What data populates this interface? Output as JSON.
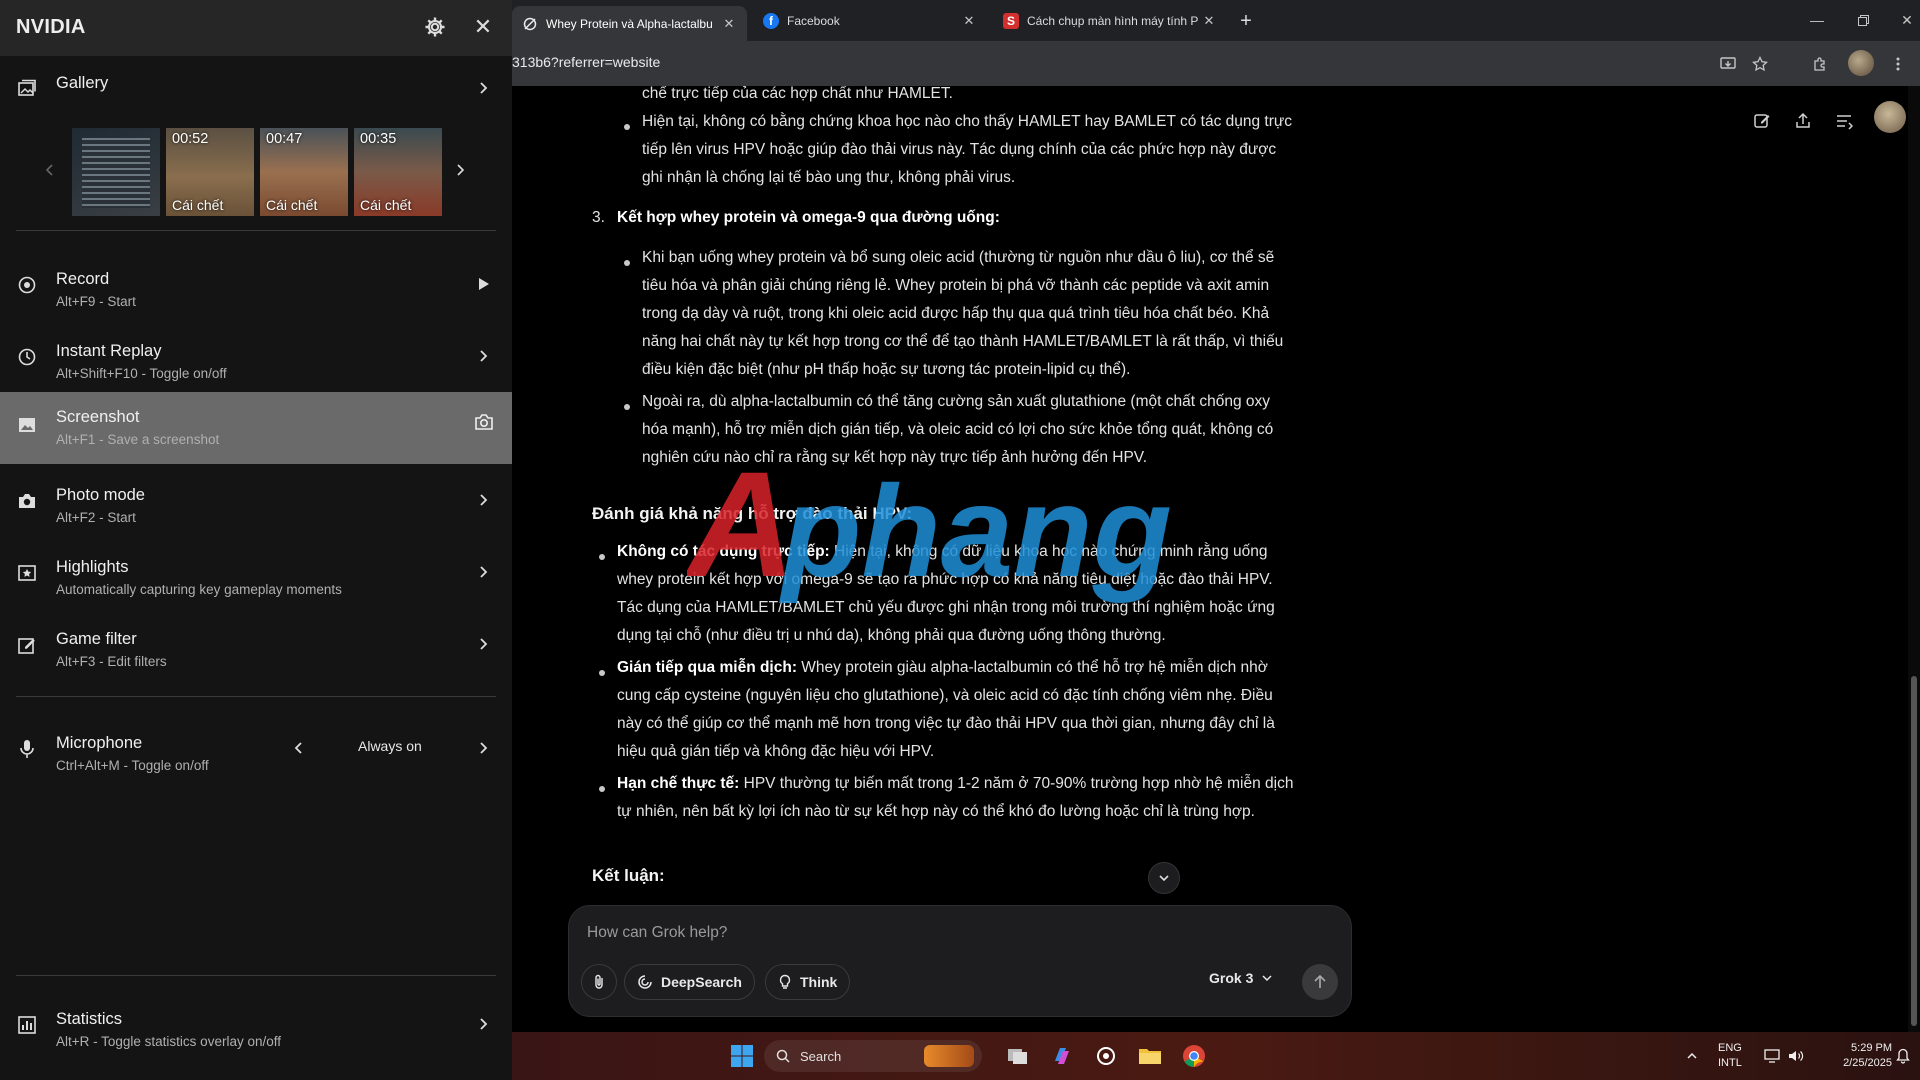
{
  "browser": {
    "tabs": [
      {
        "title": "Whey Protein và Alpha-lactalbu",
        "active": true
      },
      {
        "title": "Facebook",
        "active": false
      },
      {
        "title": "Cách chụp màn hình máy tính P",
        "active": false
      }
    ],
    "url": "313b6?referrer=website"
  },
  "article": {
    "lines_top": [
      "chế trực tiếp của các hợp chất như HAMLET.",
      "Hiện tại, không có bằng chứng khoa học nào cho thấy HAMLET hay BAMLET có tác dụng trực",
      "tiếp lên virus HPV hoặc giúp đào thải virus này. Tác dụng chính của các phức hợp này được",
      "ghi nhận là chống lại tế bào ung thư, không phải virus."
    ],
    "item3_num": "3.",
    "item3_title": "Kết hợp whey protein và omega-9 qua đường uống:",
    "item3_b1": [
      "Khi bạn uống whey protein và bổ sung oleic acid (thường từ nguồn như dầu ô liu), cơ thể sẽ",
      "tiêu hóa và phân giải chúng riêng lẻ. Whey protein bị phá vỡ thành các peptide và axit amin",
      "trong dạ dày và ruột, trong khi oleic acid được hấp thụ qua quá trình tiêu hóa chất béo. Khả",
      "năng hai chất này tự kết hợp trong cơ thể để tạo thành HAMLET/BAMLET là rất thấp, vì thiếu",
      "điều kiện đặc biệt (như pH thấp hoặc sự tương tác protein-lipid cụ thể)."
    ],
    "item3_b2": [
      "Ngoài ra, dù alpha-lactalbumin có thể tăng cường sản xuất glutathione (một chất chống oxy",
      "hóa mạnh), hỗ trợ miễn dịch gián tiếp, và oleic acid có lợi cho sức khỏe tổng quát, không có",
      "nghiên cứu nào chỉ ra rằng sự kết hợp này trực tiếp ảnh hưởng đến HPV."
    ],
    "heading_eval": "Đánh giá khả năng hỗ trợ đào thải HPV:",
    "eval1_bold": "Không có tác dụng trực tiếp:",
    "eval1": [
      " Hiện tại, không có dữ liệu khoa học nào chứng minh rằng uống",
      "whey protein kết hợp với omega-9 sẽ tạo ra phức hợp có khả năng tiêu diệt hoặc đào thải HPV.",
      "Tác dụng của HAMLET/BAMLET chủ yếu được ghi nhận trong môi trường thí nghiệm hoặc ứng",
      "dụng tại chỗ (như điều trị u nhú da), không phải qua đường uống thông thường."
    ],
    "eval2_bold": "Gián tiếp qua miễn dịch:",
    "eval2": [
      " Whey protein giàu alpha-lactalbumin có thể hỗ trợ hệ miễn dịch nhờ",
      "cung cấp cysteine (nguyên liệu cho glutathione), và oleic acid có đặc tính chống viêm nhẹ. Điều",
      "này có thể giúp cơ thể mạnh mẽ hơn trong việc tự đào thải HPV qua thời gian, nhưng đây chỉ là",
      "hiệu quả gián tiếp và không đặc hiệu với HPV."
    ],
    "eval3_bold": "Hạn chế thực tế:",
    "eval3": [
      " HPV thường tự biến mất trong 1-2 năm ở 70-90% trường hợp nhờ hệ miễn dịch",
      "tự nhiên, nên bất kỳ lợi ích nào từ sự kết hợp này có thể khó đo lường hoặc chỉ là trùng hợp."
    ],
    "heading_conclusion": "Kết luận:"
  },
  "watermark": "Aphang",
  "chat": {
    "placeholder": "How can Grok help?",
    "deepsearch": "DeepSearch",
    "think": "Think",
    "model": "Grok 3"
  },
  "taskbar": {
    "search": "Search",
    "lang": "ENG",
    "layout": "INTL",
    "time": "5:29 PM",
    "date": "2/25/2025"
  },
  "nvidia": {
    "title": "NVIDIA",
    "gallery": "Gallery",
    "thumbs": [
      {
        "duration": "",
        "caption": ""
      },
      {
        "duration": "00:52",
        "caption": "Cái chết"
      },
      {
        "duration": "00:47",
        "caption": "Cái chết"
      },
      {
        "duration": "00:35",
        "caption": "Cái chết"
      }
    ],
    "items": [
      {
        "label": "Record",
        "sub": "Alt+F9 - Start"
      },
      {
        "label": "Instant Replay",
        "sub": "Alt+Shift+F10 - Toggle on/off"
      },
      {
        "label": "Screenshot",
        "sub": "Alt+F1 - Save a screenshot"
      },
      {
        "label": "Photo mode",
        "sub": "Alt+F2 - Start"
      },
      {
        "label": "Highlights",
        "sub": "Automatically capturing key gameplay moments"
      },
      {
        "label": "Game filter",
        "sub": "Alt+F3 - Edit filters"
      }
    ],
    "microphone": {
      "label": "Microphone",
      "sub": "Ctrl+Alt+M - Toggle on/off",
      "value": "Always on"
    },
    "statistics": {
      "label": "Statistics",
      "sub": "Alt+R - Toggle statistics overlay on/off"
    }
  },
  "colors": {
    "nvidia_bg": "#141414",
    "selected": "#6a6a6a",
    "watermark_red": "#d8232a",
    "watermark_blue": "#1f8fd8"
  }
}
